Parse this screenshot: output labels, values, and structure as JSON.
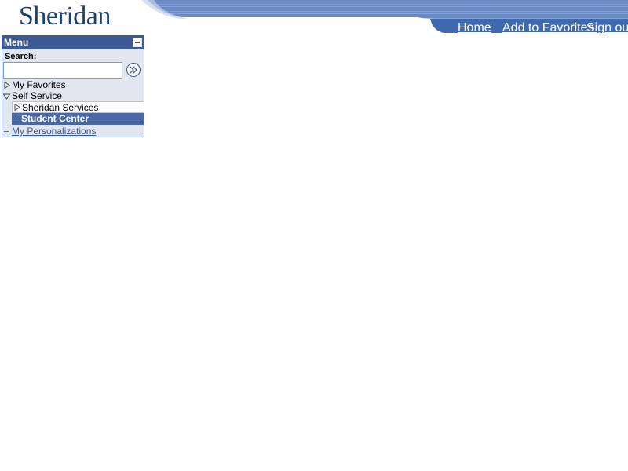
{
  "header": {
    "logo_text": "Sheridan",
    "links": {
      "home": "Home",
      "favorites": "Add to Favorites",
      "signout": "Sign out"
    }
  },
  "menu": {
    "title": "Menu",
    "search_label": "Search:",
    "search_value": "",
    "items": {
      "my_favorites": "My Favorites",
      "self_service": "Self Service",
      "sheridan_services": "Sheridan Services",
      "student_center": "Student Center",
      "my_personalizations": "My Personalizations"
    }
  },
  "colors": {
    "brand_navy": "#1b3f6e",
    "menu_header": "#3d5a95",
    "menu_bg": "#e1e6ef",
    "selected_row": "#4968a5",
    "banner_blue": "#5c7fc0"
  }
}
